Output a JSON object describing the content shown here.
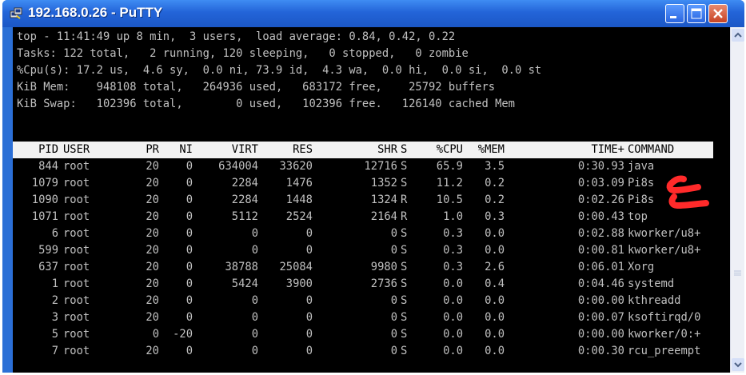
{
  "window": {
    "title": "192.168.0.26 - PuTTY"
  },
  "colors": {
    "titlebar": "#2364d8",
    "terminal_bg": "#000000",
    "terminal_fg": "#c0c0c0",
    "header_bg": "#f2f2f2",
    "annotation": "#ff2a2a"
  },
  "summary": [
    "top - 11:41:49 up 8 min,  3 users,  load average: 0.84, 0.42, 0.22",
    "Tasks: 122 total,   2 running, 120 sleeping,   0 stopped,   0 zombie",
    "%Cpu(s): 17.2 us,  4.6 sy,  0.0 ni, 73.9 id,  4.3 wa,  0.0 hi,  0.0 si,  0.0 st",
    "KiB Mem:    948108 total,   264936 used,   683172 free,    25792 buffers",
    "KiB Swap:   102396 total,        0 used,   102396 free.   126140 cached Mem"
  ],
  "table": {
    "columns": [
      "PID",
      "USER",
      "PR",
      "NI",
      "VIRT",
      "RES",
      "SHR",
      "S",
      "%CPU",
      "%MEM",
      "TIME+",
      "COMMAND"
    ],
    "rows": [
      [
        "844",
        "root",
        "20",
        "0",
        "634004",
        "33620",
        "12716",
        "S",
        "65.9",
        "3.5",
        "0:30.93",
        "java"
      ],
      [
        "1079",
        "root",
        "20",
        "0",
        "2284",
        "1476",
        "1352",
        "S",
        "11.2",
        "0.2",
        "0:03.09",
        "Pi8s"
      ],
      [
        "1090",
        "root",
        "20",
        "0",
        "2284",
        "1448",
        "1324",
        "R",
        "10.5",
        "0.2",
        "0:02.26",
        "Pi8s"
      ],
      [
        "1071",
        "root",
        "20",
        "0",
        "5112",
        "2524",
        "2164",
        "R",
        "1.0",
        "0.3",
        "0:00.43",
        "top"
      ],
      [
        "6",
        "root",
        "20",
        "0",
        "0",
        "0",
        "0",
        "S",
        "0.3",
        "0.0",
        "0:02.88",
        "kworker/u8+"
      ],
      [
        "599",
        "root",
        "20",
        "0",
        "0",
        "0",
        "0",
        "S",
        "0.3",
        "0.0",
        "0:00.81",
        "kworker/u8+"
      ],
      [
        "637",
        "root",
        "20",
        "0",
        "38788",
        "25084",
        "9980",
        "S",
        "0.3",
        "2.6",
        "0:06.01",
        "Xorg"
      ],
      [
        "1",
        "root",
        "20",
        "0",
        "5424",
        "3900",
        "2736",
        "S",
        "0.0",
        "0.4",
        "0:04.46",
        "systemd"
      ],
      [
        "2",
        "root",
        "20",
        "0",
        "0",
        "0",
        "0",
        "S",
        "0.0",
        "0.0",
        "0:00.00",
        "kthreadd"
      ],
      [
        "3",
        "root",
        "20",
        "0",
        "0",
        "0",
        "0",
        "S",
        "0.0",
        "0.0",
        "0:00.07",
        "ksoftirqd/0"
      ],
      [
        "5",
        "root",
        "0",
        "-20",
        "0",
        "0",
        "0",
        "S",
        "0.0",
        "0.0",
        "0:00.00",
        "kworker/0:+"
      ],
      [
        "7",
        "root",
        "20",
        "0",
        "0",
        "0",
        "0",
        "S",
        "0.0",
        "0.0",
        "0:00.30",
        "rcu_preempt"
      ]
    ]
  }
}
